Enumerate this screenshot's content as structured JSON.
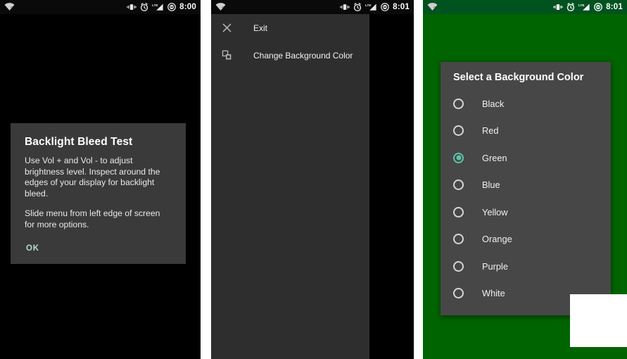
{
  "panels": [
    {
      "id": "panel-1",
      "name": "backlight-bleed-test-screen",
      "background_color": "#000000",
      "statusbar": {
        "theme": "dark",
        "background_color": "#0a0a0a",
        "clock": "8:00",
        "left_icons": [
          "wifi-no-internet-icon"
        ],
        "right_icons": [
          "vibrate-icon",
          "alarm-icon",
          "lte-signal-icon",
          "do-not-disturb-icon"
        ],
        "lte_label": "LTE"
      },
      "dialog": {
        "title": "Backlight Bleed Test",
        "paragraph_1": "Use Vol + and Vol - to adjust brightness level. Inspect around the edges of your display for backlight bleed.",
        "paragraph_2": "Slide menu from left edge of screen for more options.",
        "ok_label": "OK",
        "ok_color": "#bfd8d1",
        "background_color": "#3a3a3a"
      }
    },
    {
      "id": "panel-2",
      "name": "navigation-drawer-screen",
      "background_color": "#000000",
      "statusbar": {
        "theme": "dark",
        "background_color": "#0a0a0a",
        "clock": "8:01",
        "left_icons": [
          "wifi-no-internet-icon"
        ],
        "right_icons": [
          "vibrate-icon",
          "alarm-icon",
          "lte-signal-icon",
          "do-not-disturb-icon"
        ],
        "lte_label": "LTE"
      },
      "drawer": {
        "background_color": "#2e2e2e",
        "items": [
          {
            "label": "Exit",
            "icon": "close-x-icon"
          },
          {
            "label": "Change Background Color",
            "icon": "layers-copy-icon"
          }
        ]
      }
    },
    {
      "id": "panel-3",
      "name": "background-color-picker-screen",
      "background_color": "#006400",
      "statusbar": {
        "theme": "green",
        "background_color": "#00521f",
        "clock": "8:01",
        "left_icons": [
          "wifi-no-internet-icon"
        ],
        "right_icons": [
          "vibrate-icon",
          "alarm-icon",
          "lte-signal-icon",
          "do-not-disturb-icon"
        ],
        "lte_label": "LTE"
      },
      "dialog": {
        "title": "Select a Background Color",
        "background_color": "#474747",
        "selected_value": "Green",
        "selected_accent_color": "#5ec4a8",
        "options": [
          {
            "label": "Black",
            "selected": false
          },
          {
            "label": "Red",
            "selected": false
          },
          {
            "label": "Green",
            "selected": true
          },
          {
            "label": "Blue",
            "selected": false
          },
          {
            "label": "Yellow",
            "selected": false
          },
          {
            "label": "Orange",
            "selected": false
          },
          {
            "label": "Purple",
            "selected": false
          },
          {
            "label": "White",
            "selected": false
          }
        ]
      },
      "overlay_patch": {
        "name": "white-rectangle-overlay",
        "color": "#ffffff"
      }
    }
  ]
}
